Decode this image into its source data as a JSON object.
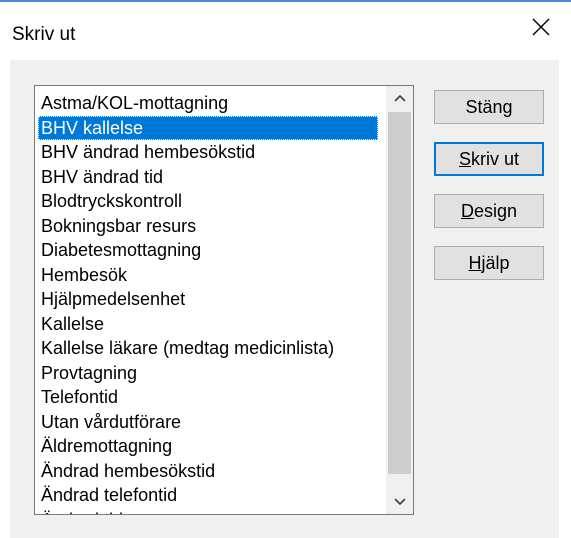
{
  "window": {
    "title": "Skriv ut"
  },
  "list": {
    "items": [
      "Astma/KOL-mottagning",
      "BHV kallelse",
      "BHV ändrad hembesökstid",
      "BHV ändrad tid",
      "Blodtryckskontroll",
      "Bokningsbar resurs",
      "Diabetesmottagning",
      "Hembesök",
      "Hjälpmedelsenhet",
      "Kallelse",
      "Kallelse läkare (medtag medicinlista)",
      "Provtagning",
      "Telefontid",
      "Utan vårdutförare",
      "Äldremottagning",
      "Ändrad hembesökstid",
      "Ändrad telefontid",
      "Ändrad tid"
    ],
    "selected_index": 1
  },
  "buttons": {
    "close": {
      "label": "Stäng"
    },
    "print": {
      "mnemonic": "S",
      "rest": "kriv ut"
    },
    "design": {
      "mnemonic": "D",
      "rest": "esign"
    },
    "help": {
      "mnemonic": "H",
      "rest": "jälp"
    }
  },
  "colors": {
    "selection": "#0078d7",
    "default_button_border": "#0078d7",
    "title_accent": "#4a8fd6"
  },
  "icons": {
    "close": "close-icon",
    "scroll_up": "chevron-up-icon",
    "scroll_down": "chevron-down-icon"
  }
}
